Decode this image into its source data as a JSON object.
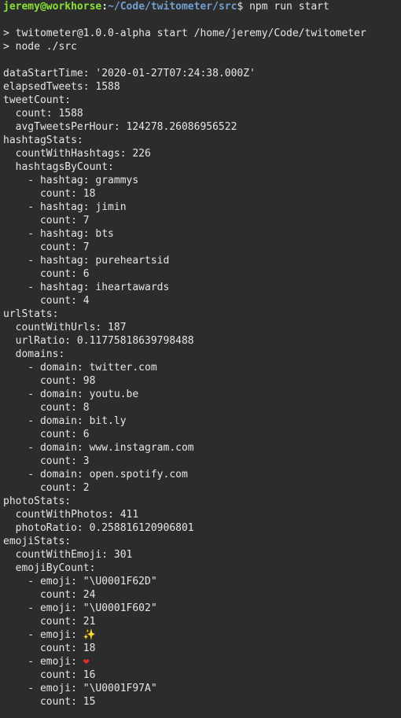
{
  "prompt": {
    "user_host": "jeremy@workhorse",
    "sep": ":",
    "path": "~/Code/twitometer/src",
    "symbol": "$",
    "command": " npm run start"
  },
  "npm_output": [
    "> twitometer@1.0.0-alpha start /home/jeremy/Code/twitometer",
    "> node ./src"
  ],
  "lines": [
    "dataStartTime: '2020-01-27T07:24:38.000Z'",
    "elapsedTweets: 1588",
    "tweetCount:",
    "  count: 1588",
    "  avgTweetsPerHour: 124278.26086956522",
    "hashtagStats:",
    "  countWithHashtags: 226",
    "  hashtagsByCount:",
    "    - hashtag: grammys",
    "      count: 18",
    "    - hashtag: jimin",
    "      count: 7",
    "    - hashtag: bts",
    "      count: 7",
    "    - hashtag: pureheartsid",
    "      count: 6",
    "    - hashtag: iheartawards",
    "      count: 4",
    "urlStats:",
    "  countWithUrls: 187",
    "  urlRatio: 0.11775818639798488",
    "  domains:",
    "    - domain: twitter.com",
    "      count: 98",
    "    - domain: youtu.be",
    "      count: 8",
    "    - domain: bit.ly",
    "      count: 6",
    "    - domain: www.instagram.com",
    "      count: 3",
    "    - domain: open.spotify.com",
    "      count: 2",
    "photoStats:",
    "  countWithPhotos: 411",
    "  photoRatio: 0.258816120906801",
    "emojiStats:",
    "  countWithEmoji: 301",
    "  emojiByCount:",
    "    - emoji: \"\\U0001F62D\"",
    "      count: 24",
    "    - emoji: \"\\U0001F602\"",
    "      count: 21"
  ],
  "emoji_sparkle_line": {
    "prefix": "    - emoji: ",
    "glyph": "✨"
  },
  "lines_after_sparkle": [
    "      count: 18"
  ],
  "emoji_heart_line": {
    "prefix": "    - emoji: ",
    "glyph": "❤"
  },
  "lines_end": [
    "      count: 16",
    "    - emoji: \"\\U0001F97A\"",
    "      count: 15"
  ],
  "colors": {
    "background": "#2c2c2c",
    "text": "#e6e6e6",
    "user": "#8ae234",
    "path": "#729fcf",
    "heart": "#e0312a",
    "sparkle": "#f6c343"
  }
}
